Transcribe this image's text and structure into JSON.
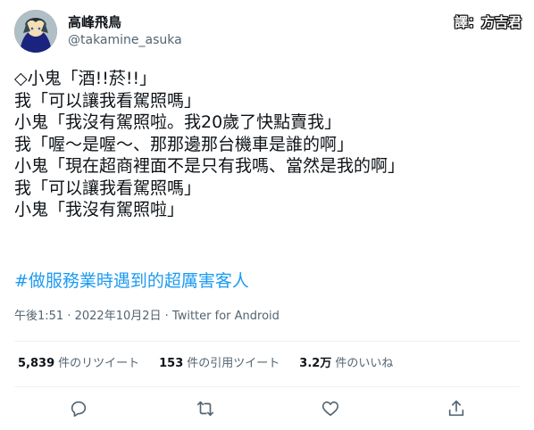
{
  "author": {
    "display_name": "高峰飛鳥",
    "handle": "@takamine_asuka"
  },
  "watermark": "譯：方吉君",
  "tweet": {
    "lines": [
      "◇小鬼「酒!!菸!!」",
      "我「可以讓我看駕照嗎」",
      "小鬼「我沒有駕照啦。我20歲了快點賣我」",
      "我「喔～是喔～、那那邊那台機車是誰的啊」",
      "小鬼「現在超商裡面不是只有我嗎、當然是我的啊」",
      "我「可以讓我看駕照嗎」",
      "小鬼「我沒有駕照啦」"
    ],
    "hashtag": "#做服務業時遇到的超厲害客人"
  },
  "meta": {
    "time": "午後1:51",
    "separator1": " · ",
    "date": "2022年10月2日",
    "separator2": " · ",
    "source": "Twitter for Android"
  },
  "stats": {
    "retweets_count": "5,839",
    "retweets_label": "件のリツイート",
    "quotes_count": "153",
    "quotes_label": "件の引用ツイート",
    "likes_count": "3.2万",
    "likes_label": "件のいいね"
  },
  "actions": {
    "icons": [
      "reply-icon",
      "retweet-icon",
      "like-icon",
      "share-icon"
    ]
  },
  "colors": {
    "text": "#0f1419",
    "secondary": "#536471",
    "link": "#1d9bf0",
    "divider": "#eff3f4"
  }
}
